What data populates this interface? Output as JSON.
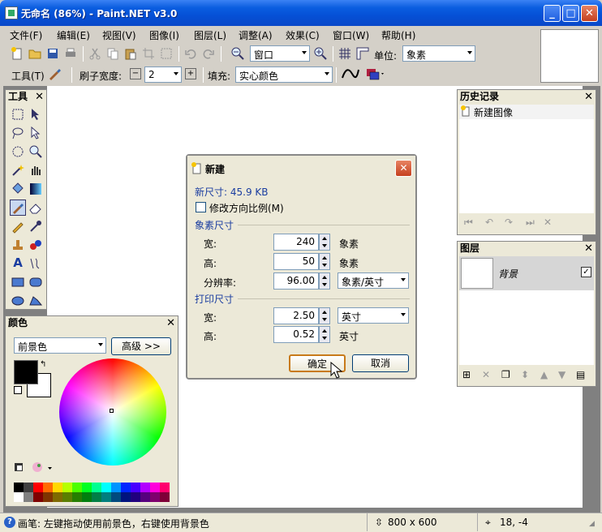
{
  "window": {
    "title": "无命名 (86%) - Paint.NET v3.0"
  },
  "menu": [
    "文件(F)",
    "编辑(E)",
    "视图(V)",
    "图像(I)",
    "图层(L)",
    "调整(A)",
    "效果(C)",
    "窗口(W)",
    "帮助(H)"
  ],
  "toolbar": {
    "zoom_value": "窗口",
    "unit_label": "单位:",
    "unit_value": "象素",
    "tool_label": "工具(T)",
    "brush_width_label": "刷子宽度:",
    "brush_width_value": "2",
    "fill_label": "填充:",
    "fill_value": "实心颜色"
  },
  "tools_panel": {
    "title": "工具"
  },
  "colors_panel": {
    "title": "颜色",
    "mode_value": "前景色",
    "advanced_label": "高级 >>",
    "palette": [
      "#000000",
      "#404040",
      "#ff0000",
      "#ff6a00",
      "#ffd800",
      "#b6ff00",
      "#4cff00",
      "#00ff21",
      "#00ff90",
      "#00ffff",
      "#0094ff",
      "#0026ff",
      "#4800ff",
      "#b200ff",
      "#ff00dc",
      "#ff006e",
      "#ffffff",
      "#808080",
      "#7f0000",
      "#7f3300",
      "#7f6a00",
      "#5b7f00",
      "#267f00",
      "#007f0e",
      "#007f46",
      "#007f7f",
      "#004a7f",
      "#00137f",
      "#21007f",
      "#57007f",
      "#7f006e",
      "#7f0037"
    ]
  },
  "history_panel": {
    "title": "历史记录",
    "items": [
      "新建图像"
    ]
  },
  "layers_panel": {
    "title": "图层",
    "layer_name": "背景"
  },
  "dialog": {
    "title": "新建",
    "new_size": "新尺寸: 45.9 KB",
    "keep_ratio_label": "修改方向比例(M)",
    "pixel_section": "象素尺寸",
    "width_label": "宽:",
    "width_value": "240",
    "width_unit": "象素",
    "height_label": "高:",
    "height_value": "50",
    "height_unit": "象素",
    "resolution_label": "分辨率:",
    "resolution_value": "96.00",
    "resolution_unit": "象素/英寸",
    "print_section": "打印尺寸",
    "print_width_label": "宽:",
    "print_width_value": "2.50",
    "print_width_unit": "英寸",
    "print_height_label": "高:",
    "print_height_value": "0.52",
    "print_height_unit": "英寸",
    "ok_label": "确定",
    "cancel_label": "取消"
  },
  "status": {
    "hint": "画笔: 左键拖动使用前景色，右键使用背景色",
    "image_size": "800 x 600",
    "cursor_pos": "18, -4"
  }
}
